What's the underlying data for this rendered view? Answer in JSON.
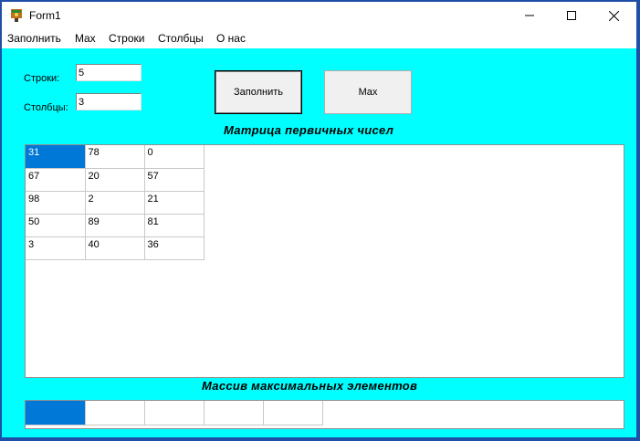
{
  "window": {
    "title": "Form1",
    "minimize_glyph": "—",
    "maximize_glyph": "☐",
    "close_glyph": "✕"
  },
  "menu": [
    "Заполнить",
    "Max",
    "Строки",
    "Столбцы",
    "О нас"
  ],
  "form": {
    "rows_label": "Строки:",
    "rows_value": "5",
    "cols_label": "Столбцы:",
    "cols_value": "3",
    "fill_button": "Заполнить",
    "max_button": "Max"
  },
  "matrix": {
    "heading": "Матрица первичных чисел",
    "rows": [
      [
        "31",
        "78",
        "0"
      ],
      [
        "67",
        "20",
        "57"
      ],
      [
        "98",
        "2",
        "21"
      ],
      [
        "50",
        "89",
        "81"
      ],
      [
        "3",
        "40",
        "36"
      ]
    ]
  },
  "max_array": {
    "heading": "Массив максимальных элементов",
    "cells": [
      "",
      "",
      "",
      "",
      ""
    ]
  },
  "colors": {
    "client_bg": "#00ffff",
    "selection": "#0078d7",
    "frame": "#1f4fa6"
  }
}
